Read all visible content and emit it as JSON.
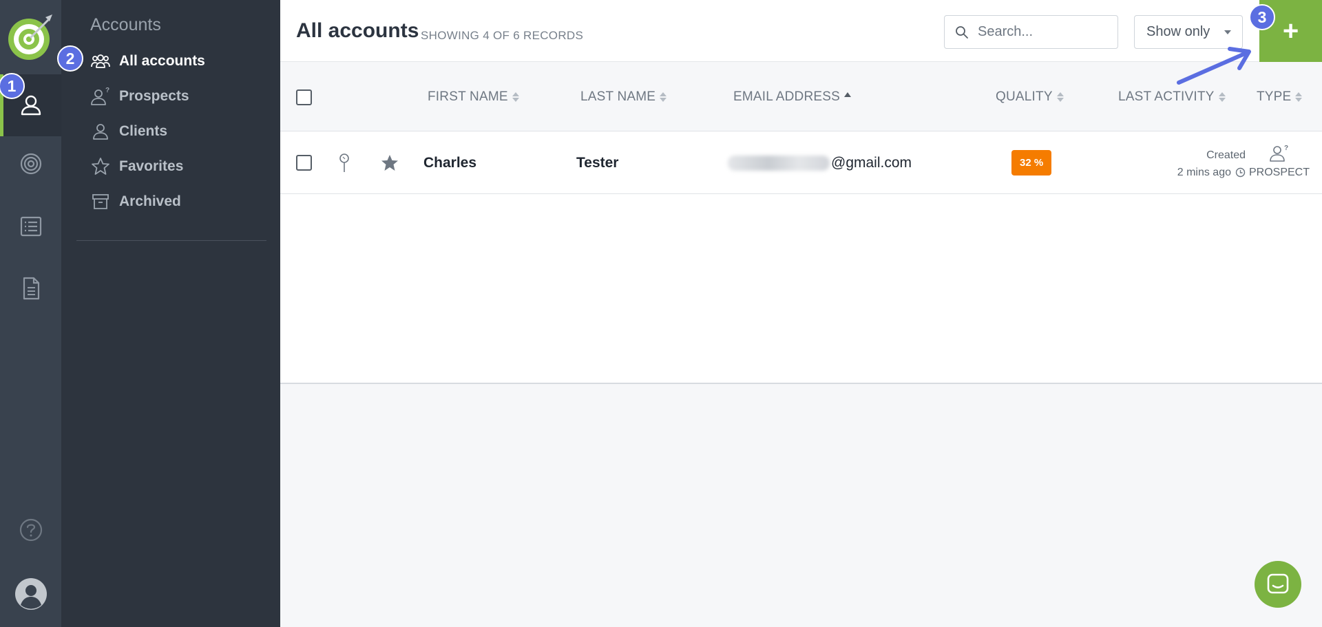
{
  "rail": {
    "items": [
      {
        "name": "accounts",
        "icon": "person-icon",
        "active": true
      },
      {
        "name": "goals",
        "icon": "target-icon",
        "active": false
      },
      {
        "name": "lists",
        "icon": "list-icon",
        "active": false
      },
      {
        "name": "documents",
        "icon": "document-icon",
        "active": false
      }
    ],
    "bottom": [
      {
        "name": "help",
        "icon": "help-icon"
      },
      {
        "name": "profile",
        "icon": "avatar-icon"
      }
    ]
  },
  "subnav": {
    "title": "Accounts",
    "items": [
      {
        "label": "All accounts",
        "icon": "group-icon",
        "active": true
      },
      {
        "label": "Prospects",
        "icon": "prospect-icon",
        "active": false
      },
      {
        "label": "Clients",
        "icon": "person-icon",
        "active": false
      },
      {
        "label": "Favorites",
        "icon": "star-icon",
        "active": false
      },
      {
        "label": "Archived",
        "icon": "archive-icon",
        "active": false
      }
    ]
  },
  "header": {
    "title": "All accounts",
    "record_count": "SHOWING 4 OF 6 RECORDS",
    "search_placeholder": "Search...",
    "show_only_label": "Show only",
    "add_label": "+"
  },
  "table": {
    "columns": [
      "FIRST NAME",
      "LAST NAME",
      "EMAIL ADDRESS",
      "QUALITY",
      "LAST ACTIVITY",
      "TYPE"
    ],
    "rows": [
      {
        "first_name": "Charles",
        "last_name": "Tester",
        "email_domain": "@gmail.com",
        "quality": "32 %",
        "activity_label": "Created",
        "activity_time": "2 mins ago",
        "type": "PROSPECT"
      }
    ]
  },
  "annotations": {
    "badge1": "1",
    "badge2": "2",
    "badge3": "3"
  },
  "colors": {
    "rail_bg": "#39424e",
    "subnav_bg": "#2d343e",
    "accent_green": "#7cb342",
    "quality_orange": "#f57c00",
    "badge_blue": "#5b6ee1"
  }
}
